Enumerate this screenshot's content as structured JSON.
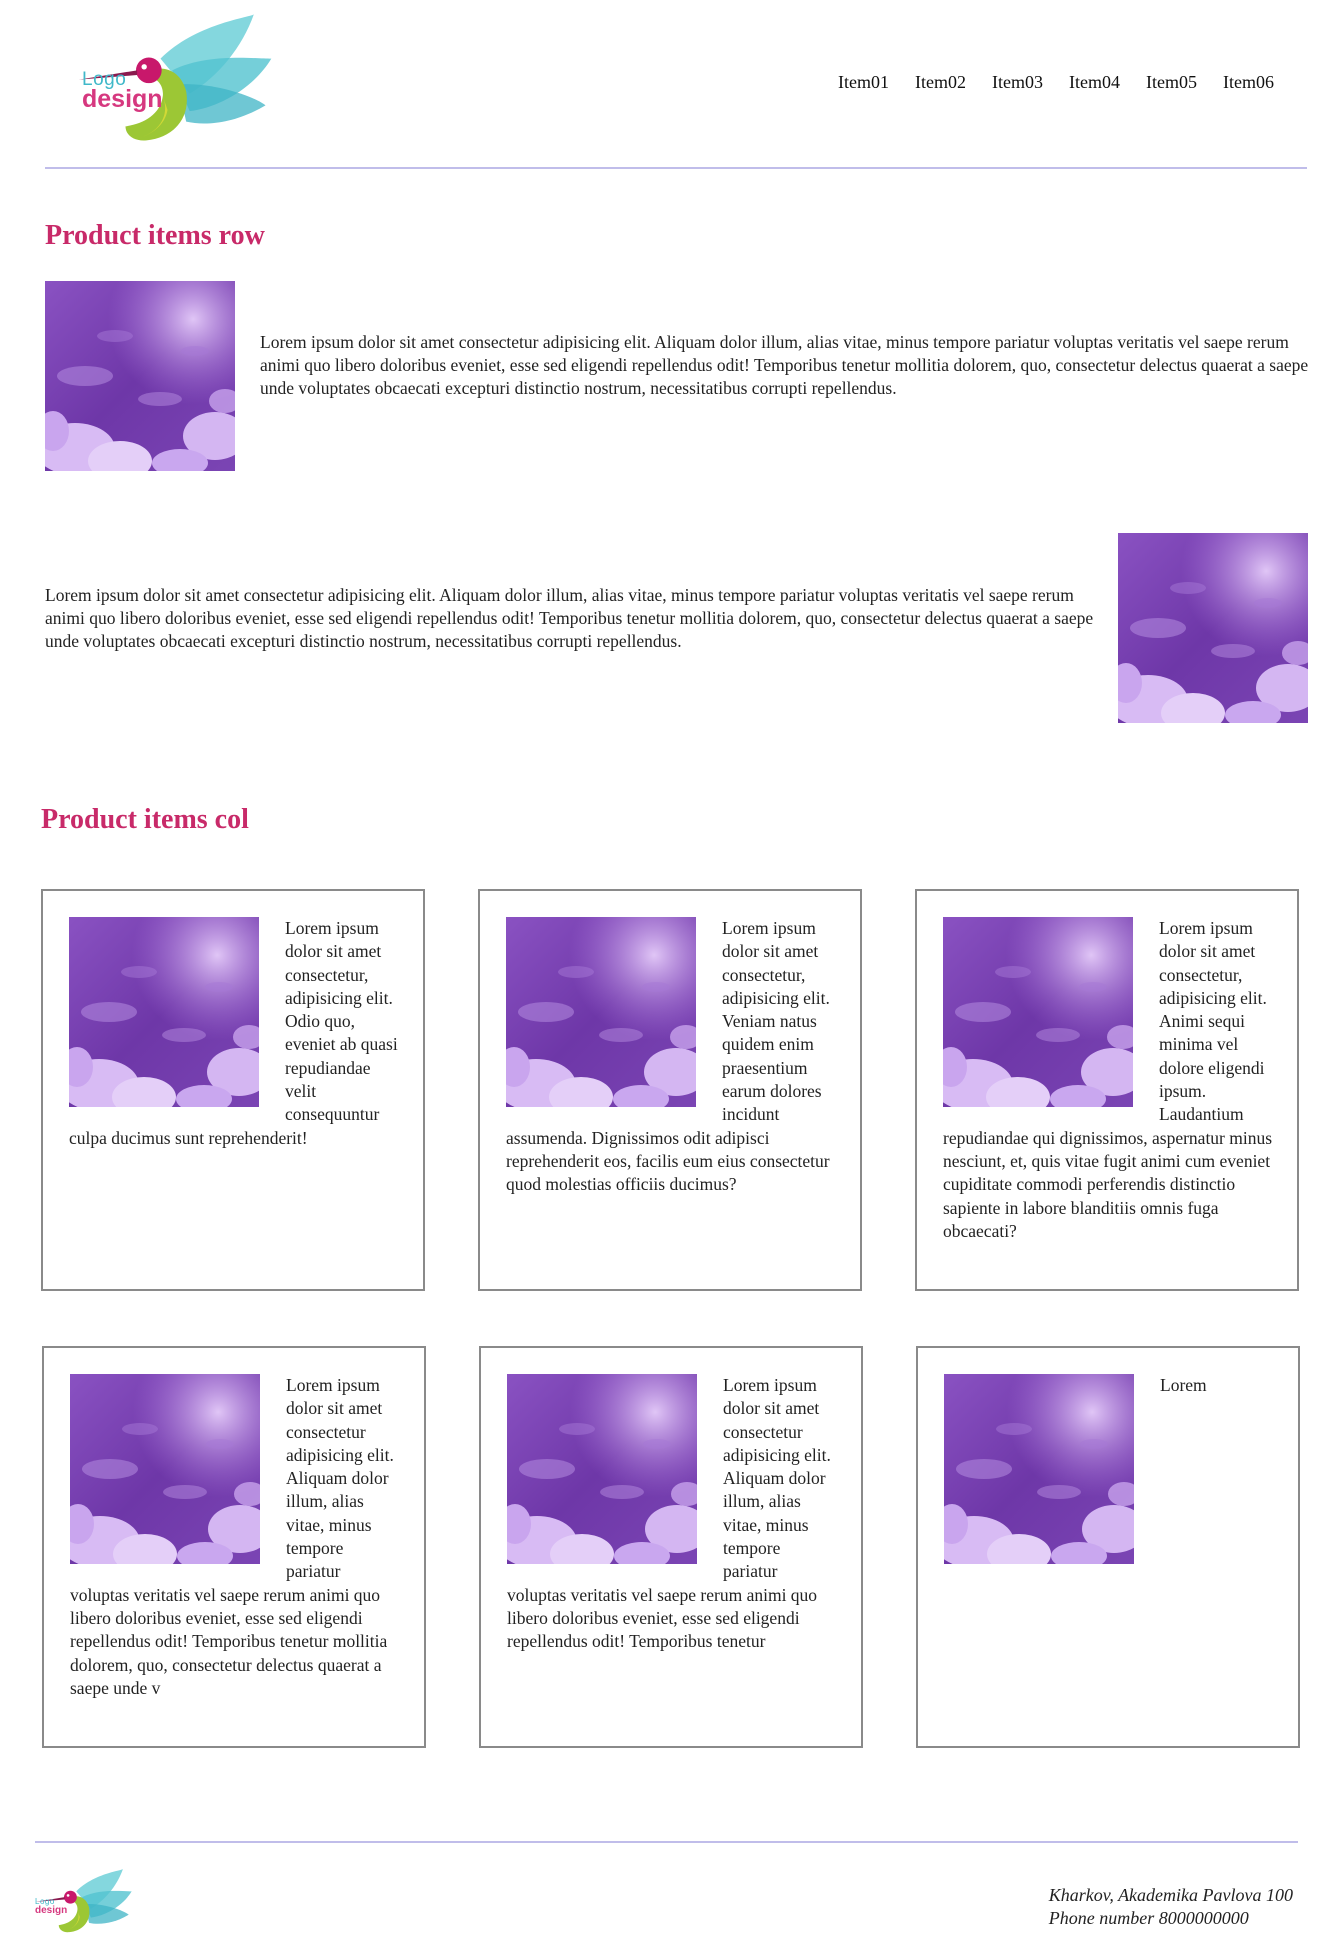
{
  "logo": {
    "line1": "Logo",
    "line2": "design"
  },
  "nav": {
    "items": [
      "Item01",
      "Item02",
      "Item03",
      "Item04",
      "Item05",
      "Item06"
    ]
  },
  "sections": {
    "row_title": "Product items row",
    "col_title": "Product items col"
  },
  "row_items": [
    {
      "text": "Lorem ipsum dolor sit amet consectetur adipisicing elit. Aliquam dolor illum, alias vitae, minus tempore pariatur voluptas veritatis vel saepe rerum animi quo libero doloribus eveniet, esse sed eligendi repellendus odit! Temporibus tenetur mollitia dolorem, quo, consectetur delectus quaerat a saepe unde voluptates obcaecati excepturi distinctio nostrum, necessitatibus corrupti repellendus."
    },
    {
      "text": "Lorem ipsum dolor sit amet consectetur adipisicing elit. Aliquam dolor illum, alias vitae, minus tempore pariatur voluptas veritatis vel saepe rerum animi quo libero doloribus eveniet, esse sed eligendi repellendus odit! Temporibus tenetur mollitia dolorem, quo, consectetur delectus quaerat a saepe unde voluptates obcaecati excepturi distinctio nostrum, necessitatibus corrupti repellendus."
    }
  ],
  "col_items": [
    {
      "text": "Lorem ipsum dolor sit amet consectetur, adipisicing elit. Odio quo, eveniet ab quasi repudiandae velit consequuntur culpa ducimus sunt reprehenderit!"
    },
    {
      "text": "Lorem ipsum dolor sit amet consectetur, adipisicing elit. Veniam natus quidem enim praesentium earum dolores incidunt assumenda. Dignissimos odit adipisci reprehenderit eos, facilis eum eius consectetur quod molestias officiis ducimus?"
    },
    {
      "text": "Lorem ipsum dolor sit amet consectetur, adipisicing elit. Animi sequi minima vel dolore eligendi ipsum. Laudantium repudiandae qui dignissimos, aspernatur minus nesciunt, et, quis vitae fugit animi cum eveniet cupiditate commodi perferendis distinctio sapiente in labore blanditiis omnis fuga obcaecati?"
    },
    {
      "text": "Lorem ipsum dolor sit amet consectetur adipisicing elit. Aliquam dolor illum, alias vitae, minus tempore pariatur voluptas veritatis vel saepe rerum animi quo libero doloribus eveniet, esse sed eligendi repellendus odit! Temporibus tenetur mollitia dolorem, quo, consectetur delectus quaerat a saepe unde v"
    },
    {
      "text": "Lorem ipsum dolor sit amet consectetur adipisicing elit. Aliquam dolor illum, alias vitae, minus tempore pariatur voluptas veritatis vel saepe rerum animi quo libero doloribus eveniet, esse sed eligendi repellendus odit! Temporibus tenetur"
    },
    {
      "text": "Lorem"
    }
  ],
  "footer": {
    "address": "Kharkov, Akademika Pavlova 100",
    "phone": "Phone number 8000000000"
  },
  "colors": {
    "heading": "#c82a69",
    "divider": "#c0bdea",
    "card_border": "#8a8a8a",
    "image_purple": "#7a3fb0"
  }
}
